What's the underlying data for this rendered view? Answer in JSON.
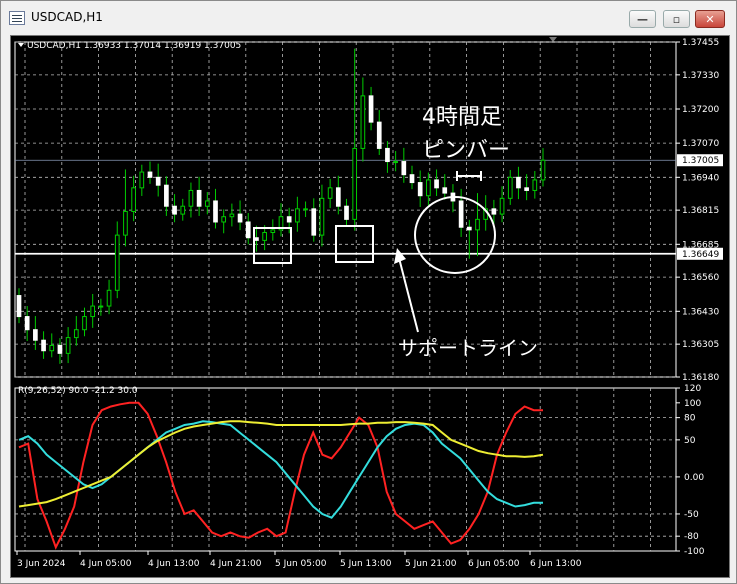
{
  "window": {
    "title": "USDCAD,H1"
  },
  "buttons": {
    "minimize": "—",
    "maximize": "▫",
    "close": "✕"
  },
  "chart_data": [
    {
      "type": "candlestick",
      "info": "USDCAD,H1  1.36933 1.37014 1.36919 1.37005",
      "price_axis": [
        "1.37455",
        "1.37330",
        "1.37200",
        "1.37070",
        "1.36940",
        "1.36815",
        "1.36685",
        "1.36560",
        "1.36430",
        "1.36305",
        "1.36180"
      ],
      "ylim": [
        1.3618,
        1.37455
      ],
      "current_price": "1.37005",
      "support_price": "1.36649",
      "time_axis": [
        "3 Jun 2024",
        "4 Jun 05:00",
        "4 Jun 13:00",
        "4 Jun 21:00",
        "5 Jun 05:00",
        "5 Jun 13:00",
        "5 Jun 21:00",
        "6 Jun 05:00",
        "6 Jun 13:00"
      ],
      "annotations": {
        "candle": "4時間足",
        "pinbar": "ピンバー",
        "support": "サポートライン"
      },
      "closes": [
        1.3641,
        1.3636,
        1.3632,
        1.3628,
        1.363,
        1.3627,
        1.3633,
        1.3636,
        1.3641,
        1.3645,
        1.3645,
        1.3651,
        1.3672,
        1.3681,
        1.369,
        1.3696,
        1.3694,
        1.3691,
        1.3683,
        1.368,
        1.3683,
        1.3689,
        1.3683,
        1.3685,
        1.3677,
        1.3679,
        1.368,
        1.3677,
        1.3671,
        1.367,
        1.3673,
        1.3674,
        1.3679,
        1.3677,
        1.3682,
        1.3682,
        1.3672,
        1.3686,
        1.369,
        1.3683,
        1.3678,
        1.3705,
        1.3725,
        1.3715,
        1.3705,
        1.37,
        1.37,
        1.3695,
        1.3692,
        1.3687,
        1.3693,
        1.369,
        1.3688,
        1.3685,
        1.3675,
        1.3674,
        1.3678,
        1.3682,
        1.368,
        1.3686,
        1.3694,
        1.369,
        1.3689,
        1.3693,
        1.37005
      ]
    },
    {
      "type": "line",
      "title": "R(9,26,52) 90.0 -21.2 30.0",
      "axis": [
        "120",
        "100",
        "80",
        "50",
        "0.00",
        "-50",
        "-80",
        "-100"
      ],
      "ylim": [
        -100,
        120
      ],
      "series": [
        {
          "color": "#ff2222",
          "values": [
            40,
            45,
            -30,
            -60,
            -95,
            -70,
            -40,
            20,
            70,
            90,
            95,
            98,
            100,
            100,
            85,
            55,
            20,
            -20,
            -50,
            -45,
            -60,
            -75,
            -80,
            -75,
            -80,
            -82,
            -75,
            -70,
            -80,
            -75,
            -20,
            30,
            60,
            30,
            25,
            40,
            60,
            80,
            70,
            40,
            -20,
            -50,
            -60,
            -70,
            -65,
            -60,
            -75,
            -90,
            -85,
            -70,
            -50,
            -20,
            30,
            60,
            85,
            95,
            90,
            90
          ]
        },
        {
          "color": "#33dddd",
          "values": [
            50,
            55,
            45,
            30,
            20,
            10,
            0,
            -10,
            -15,
            -10,
            0,
            10,
            20,
            30,
            40,
            50,
            60,
            65,
            70,
            72,
            75,
            74,
            72,
            70,
            60,
            50,
            40,
            30,
            20,
            5,
            -10,
            -25,
            -40,
            -50,
            -55,
            -40,
            -20,
            0,
            20,
            40,
            55,
            65,
            70,
            72,
            70,
            60,
            45,
            35,
            25,
            10,
            -5,
            -20,
            -30,
            -35,
            -40,
            -38,
            -35,
            -35
          ]
        },
        {
          "color": "#eeee33",
          "values": [
            -40,
            -38,
            -36,
            -34,
            -30,
            -25,
            -20,
            -15,
            -10,
            -5,
            0,
            10,
            20,
            30,
            40,
            48,
            54,
            60,
            65,
            68,
            70,
            72,
            74,
            75,
            75,
            74,
            73,
            72,
            70,
            70,
            70,
            70,
            70,
            70,
            70,
            70,
            71,
            72,
            72,
            73,
            73,
            74,
            74,
            73,
            72,
            70,
            60,
            50,
            45,
            40,
            35,
            32,
            30,
            28,
            28,
            27,
            28,
            30
          ]
        }
      ]
    }
  ]
}
